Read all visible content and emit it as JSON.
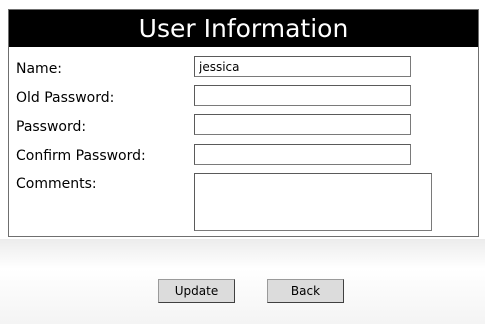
{
  "panel": {
    "title": "User Information"
  },
  "form": {
    "name_label": "Name:",
    "name_value": "jessica",
    "old_password_label": "Old Password:",
    "old_password_value": "",
    "password_label": "Password:",
    "password_value": "",
    "confirm_password_label": "Confirm Password:",
    "confirm_password_value": "",
    "comments_label": "Comments:",
    "comments_value": ""
  },
  "buttons": {
    "update_label": "Update",
    "back_label": "Back"
  }
}
